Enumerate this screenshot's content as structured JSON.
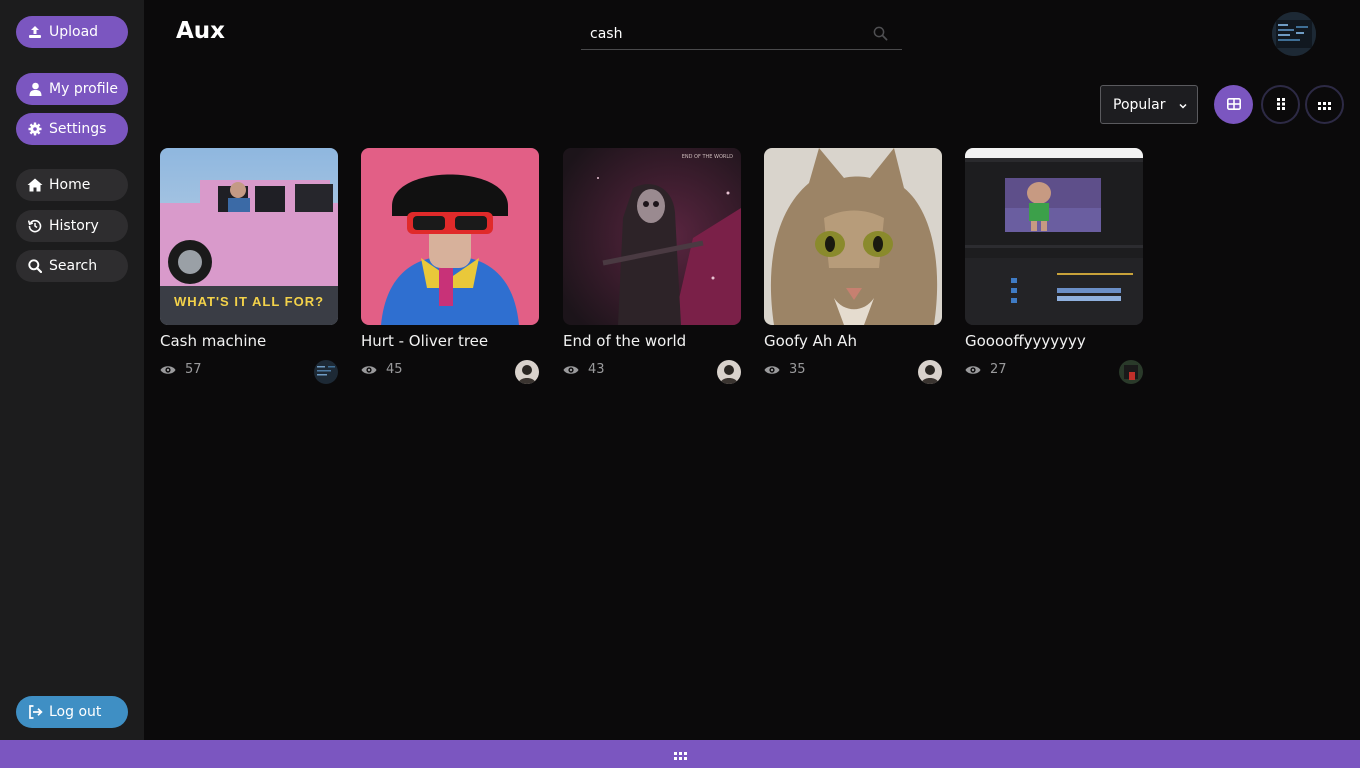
{
  "app": {
    "title": "Aux"
  },
  "sidebar": {
    "upload": "Upload",
    "my_profile": "My profile",
    "settings": "Settings",
    "home": "Home",
    "history": "History",
    "search": "Search",
    "logout": "Log out"
  },
  "search": {
    "value": "cash",
    "icon": "search-icon"
  },
  "sort": {
    "selected": "Popular"
  },
  "view_modes": [
    "grid-large-icon",
    "grid-medium-icon",
    "grid-small-icon"
  ],
  "cards": [
    {
      "title": "Cash machine",
      "views": "57"
    },
    {
      "title": "Hurt - Oliver tree",
      "views": "45"
    },
    {
      "title": "End of the world",
      "views": "43"
    },
    {
      "title": "Goofy Ah Ah",
      "views": "35"
    },
    {
      "title": "Gooooffyyyyyyy",
      "views": "27"
    }
  ],
  "colors": {
    "accent": "#7b56c0",
    "logout": "#3f8fc4",
    "sidebar": "#1c1c1d",
    "background": "#0b0a0b"
  }
}
